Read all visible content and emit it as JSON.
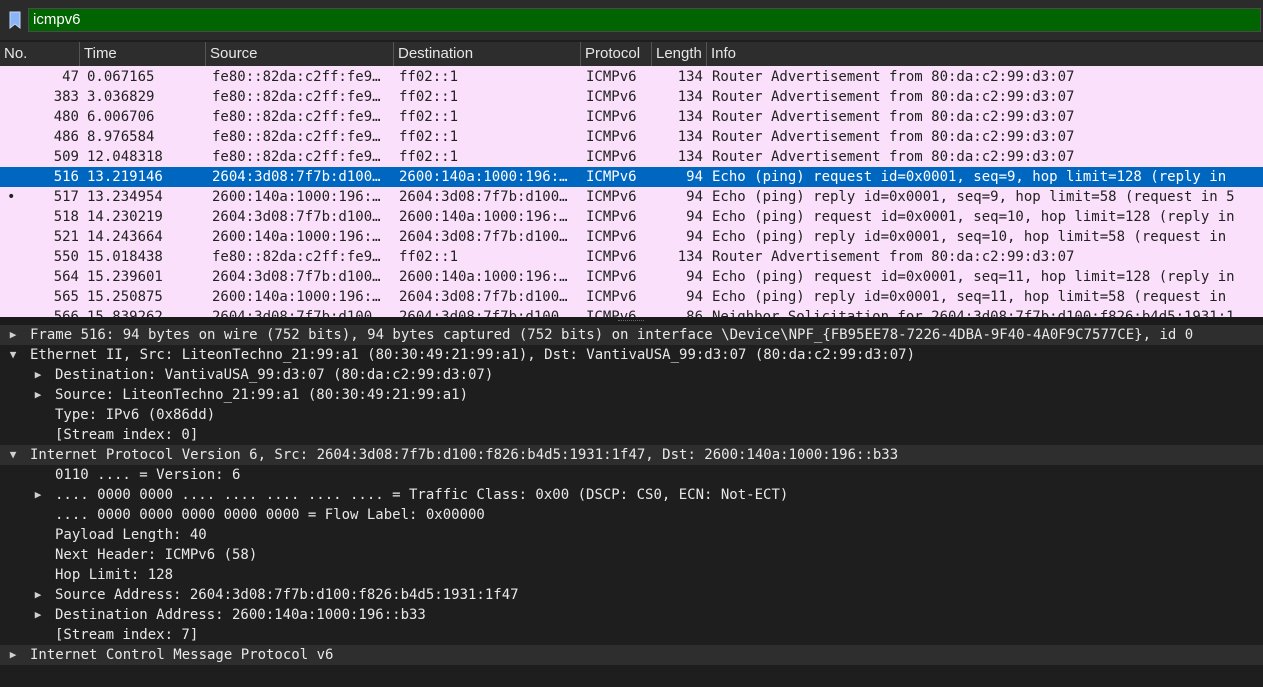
{
  "filter": {
    "value": "icmpv6",
    "background": "#006400"
  },
  "packet_list": {
    "columns": [
      "No.",
      "Time",
      "Source",
      "Destination",
      "Protocol",
      "Length",
      "Info"
    ],
    "rows": [
      {
        "no": "47",
        "time": "0.067165",
        "src": "fe80::82da:c2ff:fe9…",
        "dst": "ff02::1",
        "proto": "ICMPv6",
        "len": "134",
        "info": "Router Advertisement from 80:da:c2:99:d3:07",
        "selected": false,
        "mark": ""
      },
      {
        "no": "383",
        "time": "3.036829",
        "src": "fe80::82da:c2ff:fe9…",
        "dst": "ff02::1",
        "proto": "ICMPv6",
        "len": "134",
        "info": "Router Advertisement from 80:da:c2:99:d3:07",
        "selected": false,
        "mark": ""
      },
      {
        "no": "480",
        "time": "6.006706",
        "src": "fe80::82da:c2ff:fe9…",
        "dst": "ff02::1",
        "proto": "ICMPv6",
        "len": "134",
        "info": "Router Advertisement from 80:da:c2:99:d3:07",
        "selected": false,
        "mark": ""
      },
      {
        "no": "486",
        "time": "8.976584",
        "src": "fe80::82da:c2ff:fe9…",
        "dst": "ff02::1",
        "proto": "ICMPv6",
        "len": "134",
        "info": "Router Advertisement from 80:da:c2:99:d3:07",
        "selected": false,
        "mark": ""
      },
      {
        "no": "509",
        "time": "12.048318",
        "src": "fe80::82da:c2ff:fe9…",
        "dst": "ff02::1",
        "proto": "ICMPv6",
        "len": "134",
        "info": "Router Advertisement from 80:da:c2:99:d3:07",
        "selected": false,
        "mark": ""
      },
      {
        "no": "516",
        "time": "13.219146",
        "src": "2604:3d08:7f7b:d100…",
        "dst": "2600:140a:1000:196:…",
        "proto": "ICMPv6",
        "len": "94",
        "info": "Echo (ping) request id=0x0001, seq=9, hop limit=128 (reply in",
        "selected": true,
        "mark": ""
      },
      {
        "no": "517",
        "time": "13.234954",
        "src": "2600:140a:1000:196:…",
        "dst": "2604:3d08:7f7b:d100…",
        "proto": "ICMPv6",
        "len": "94",
        "info": "Echo (ping) reply id=0x0001, seq=9, hop limit=58 (request in 5",
        "selected": false,
        "mark": "•"
      },
      {
        "no": "518",
        "time": "14.230219",
        "src": "2604:3d08:7f7b:d100…",
        "dst": "2600:140a:1000:196:…",
        "proto": "ICMPv6",
        "len": "94",
        "info": "Echo (ping) request id=0x0001, seq=10, hop limit=128 (reply in",
        "selected": false,
        "mark": ""
      },
      {
        "no": "521",
        "time": "14.243664",
        "src": "2600:140a:1000:196:…",
        "dst": "2604:3d08:7f7b:d100…",
        "proto": "ICMPv6",
        "len": "94",
        "info": "Echo (ping) reply id=0x0001, seq=10, hop limit=58 (request in",
        "selected": false,
        "mark": ""
      },
      {
        "no": "550",
        "time": "15.018438",
        "src": "fe80::82da:c2ff:fe9…",
        "dst": "ff02::1",
        "proto": "ICMPv6",
        "len": "134",
        "info": "Router Advertisement from 80:da:c2:99:d3:07",
        "selected": false,
        "mark": ""
      },
      {
        "no": "564",
        "time": "15.239601",
        "src": "2604:3d08:7f7b:d100…",
        "dst": "2600:140a:1000:196:…",
        "proto": "ICMPv6",
        "len": "94",
        "info": "Echo (ping) request id=0x0001, seq=11, hop limit=128 (reply in",
        "selected": false,
        "mark": ""
      },
      {
        "no": "565",
        "time": "15.250875",
        "src": "2600:140a:1000:196:…",
        "dst": "2604:3d08:7f7b:d100…",
        "proto": "ICMPv6",
        "len": "94",
        "info": "Echo (ping) reply id=0x0001, seq=11, hop limit=58 (request in",
        "selected": false,
        "mark": ""
      },
      {
        "no": "566",
        "time": "15.839262",
        "src": "2604:3d08:7f7b:d100…",
        "dst": "2604:3d08:7f7b:d100…",
        "proto": "ICMPv6",
        "len": "86",
        "info": "Neighbor Solicitation for 2604:3d08:7f7b:d100:f826:b4d5:1931:1",
        "selected": false,
        "mark": ""
      }
    ],
    "colors": {
      "row_bg": "#fbe0fc",
      "selected_bg": "#0067c0"
    }
  },
  "details": {
    "rows": [
      {
        "level": 0,
        "arrow": "right",
        "text": "Frame 516: 94 bytes on wire (752 bits), 94 bytes captured (752 bits) on interface \\Device\\NPF_{FB95EE78-7226-4DBA-9F40-4A0F9C7577CE}, id 0",
        "hl": true
      },
      {
        "level": 0,
        "arrow": "down",
        "text": "Ethernet II, Src: LiteonTechno_21:99:a1 (80:30:49:21:99:a1), Dst: VantivaUSA_99:d3:07 (80:da:c2:99:d3:07)",
        "hl": false
      },
      {
        "level": 1,
        "arrow": "right",
        "text": "Destination: VantivaUSA_99:d3:07 (80:da:c2:99:d3:07)",
        "hl": false
      },
      {
        "level": 1,
        "arrow": "right",
        "text": "Source: LiteonTechno_21:99:a1 (80:30:49:21:99:a1)",
        "hl": false
      },
      {
        "level": 1,
        "arrow": "",
        "text": "Type: IPv6 (0x86dd)",
        "hl": false
      },
      {
        "level": 1,
        "arrow": "",
        "text": "[Stream index: 0]",
        "hl": false
      },
      {
        "level": 0,
        "arrow": "down",
        "text": "Internet Protocol Version 6, Src: 2604:3d08:7f7b:d100:f826:b4d5:1931:1f47, Dst: 2600:140a:1000:196::b33",
        "hl": true
      },
      {
        "level": 1,
        "arrow": "",
        "text": "0110 .... = Version: 6",
        "hl": false
      },
      {
        "level": 1,
        "arrow": "right",
        "text": ".... 0000 0000 .... .... .... .... .... = Traffic Class: 0x00 (DSCP: CS0, ECN: Not-ECT)",
        "hl": false
      },
      {
        "level": 1,
        "arrow": "",
        "text": ".... 0000 0000 0000 0000 0000 = Flow Label: 0x00000",
        "hl": false
      },
      {
        "level": 1,
        "arrow": "",
        "text": "Payload Length: 40",
        "hl": false
      },
      {
        "level": 1,
        "arrow": "",
        "text": "Next Header: ICMPv6 (58)",
        "hl": false
      },
      {
        "level": 1,
        "arrow": "",
        "text": "Hop Limit: 128",
        "hl": false
      },
      {
        "level": 1,
        "arrow": "right",
        "text": "Source Address: 2604:3d08:7f7b:d100:f826:b4d5:1931:1f47",
        "hl": false
      },
      {
        "level": 1,
        "arrow": "right",
        "text": "Destination Address: 2600:140a:1000:196::b33",
        "hl": false
      },
      {
        "level": 1,
        "arrow": "",
        "text": "[Stream index: 7]",
        "hl": false
      },
      {
        "level": 0,
        "arrow": "right",
        "text": "Internet Control Message Protocol v6",
        "hl": true
      }
    ]
  }
}
